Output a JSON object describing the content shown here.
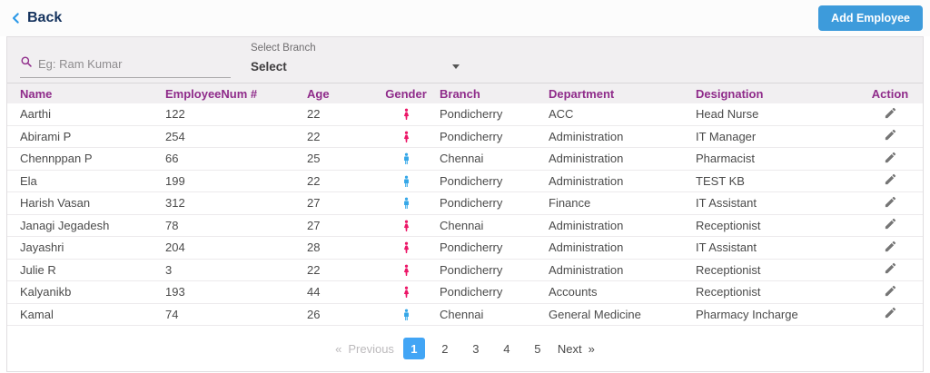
{
  "topbar": {
    "back_label": "Back",
    "add_button_label": "Add Employee"
  },
  "filters": {
    "search_placeholder": "Eg: Ram Kumar",
    "branch_label": "Select Branch",
    "branch_value": "Select"
  },
  "icons": {
    "back": "chevron-left",
    "search": "magnifier",
    "branch": "caret-down",
    "female": "female-person-silhouette",
    "male": "male-person-silhouette",
    "action": "edit-pencil"
  },
  "colors": {
    "header_purple": "#8f2b8a",
    "back_navy": "#15335e",
    "back_chevron_blue": "#2c99e8",
    "add_button_blue": "#3d9bdb",
    "female_pink": "#ec1768",
    "male_blue": "#35a7e8",
    "active_page_blue": "#42a5f5",
    "pencil_gray": "#757575"
  },
  "table": {
    "columns": [
      "Name",
      "EmployeeNum #",
      "Age",
      "Gender",
      "Branch",
      "Department",
      "Designation",
      "Action"
    ],
    "rows": [
      {
        "name": "Aarthi",
        "employee_num": "122",
        "age": "22",
        "gender": "female",
        "branch": "Pondicherry",
        "department": "ACC",
        "designation": "Head Nurse"
      },
      {
        "name": "Abirami P",
        "employee_num": "254",
        "age": "22",
        "gender": "female",
        "branch": "Pondicherry",
        "department": "Administration",
        "designation": "IT Manager"
      },
      {
        "name": "Chennppan P",
        "employee_num": "66",
        "age": "25",
        "gender": "male",
        "branch": "Chennai",
        "department": "Administration",
        "designation": "Pharmacist"
      },
      {
        "name": "Ela",
        "employee_num": "199",
        "age": "22",
        "gender": "male",
        "branch": "Pondicherry",
        "department": "Administration",
        "designation": "TEST KB"
      },
      {
        "name": "Harish Vasan",
        "employee_num": "312",
        "age": "27",
        "gender": "male",
        "branch": "Pondicherry",
        "department": "Finance",
        "designation": "IT Assistant"
      },
      {
        "name": "Janagi Jegadesh",
        "employee_num": "78",
        "age": "27",
        "gender": "female",
        "branch": "Chennai",
        "department": "Administration",
        "designation": "Receptionist"
      },
      {
        "name": "Jayashri",
        "employee_num": "204",
        "age": "28",
        "gender": "female",
        "branch": "Pondicherry",
        "department": "Administration",
        "designation": "IT Assistant"
      },
      {
        "name": "Julie R",
        "employee_num": "3",
        "age": "22",
        "gender": "female",
        "branch": "Pondicherry",
        "department": "Administration",
        "designation": "Receptionist"
      },
      {
        "name": "Kalyanikb",
        "employee_num": "193",
        "age": "44",
        "gender": "female",
        "branch": "Pondicherry",
        "department": "Accounts",
        "designation": "Receptionist"
      },
      {
        "name": "Kamal",
        "employee_num": "74",
        "age": "26",
        "gender": "male",
        "branch": "Chennai",
        "department": "General Medicine",
        "designation": "Pharmacy Incharge"
      }
    ]
  },
  "pagination": {
    "prev_symbol": "«",
    "prev_label": "Previous",
    "pages": [
      "1",
      "2",
      "3",
      "4",
      "5"
    ],
    "active_page": "1",
    "next_label": "Next",
    "next_symbol": "»"
  }
}
